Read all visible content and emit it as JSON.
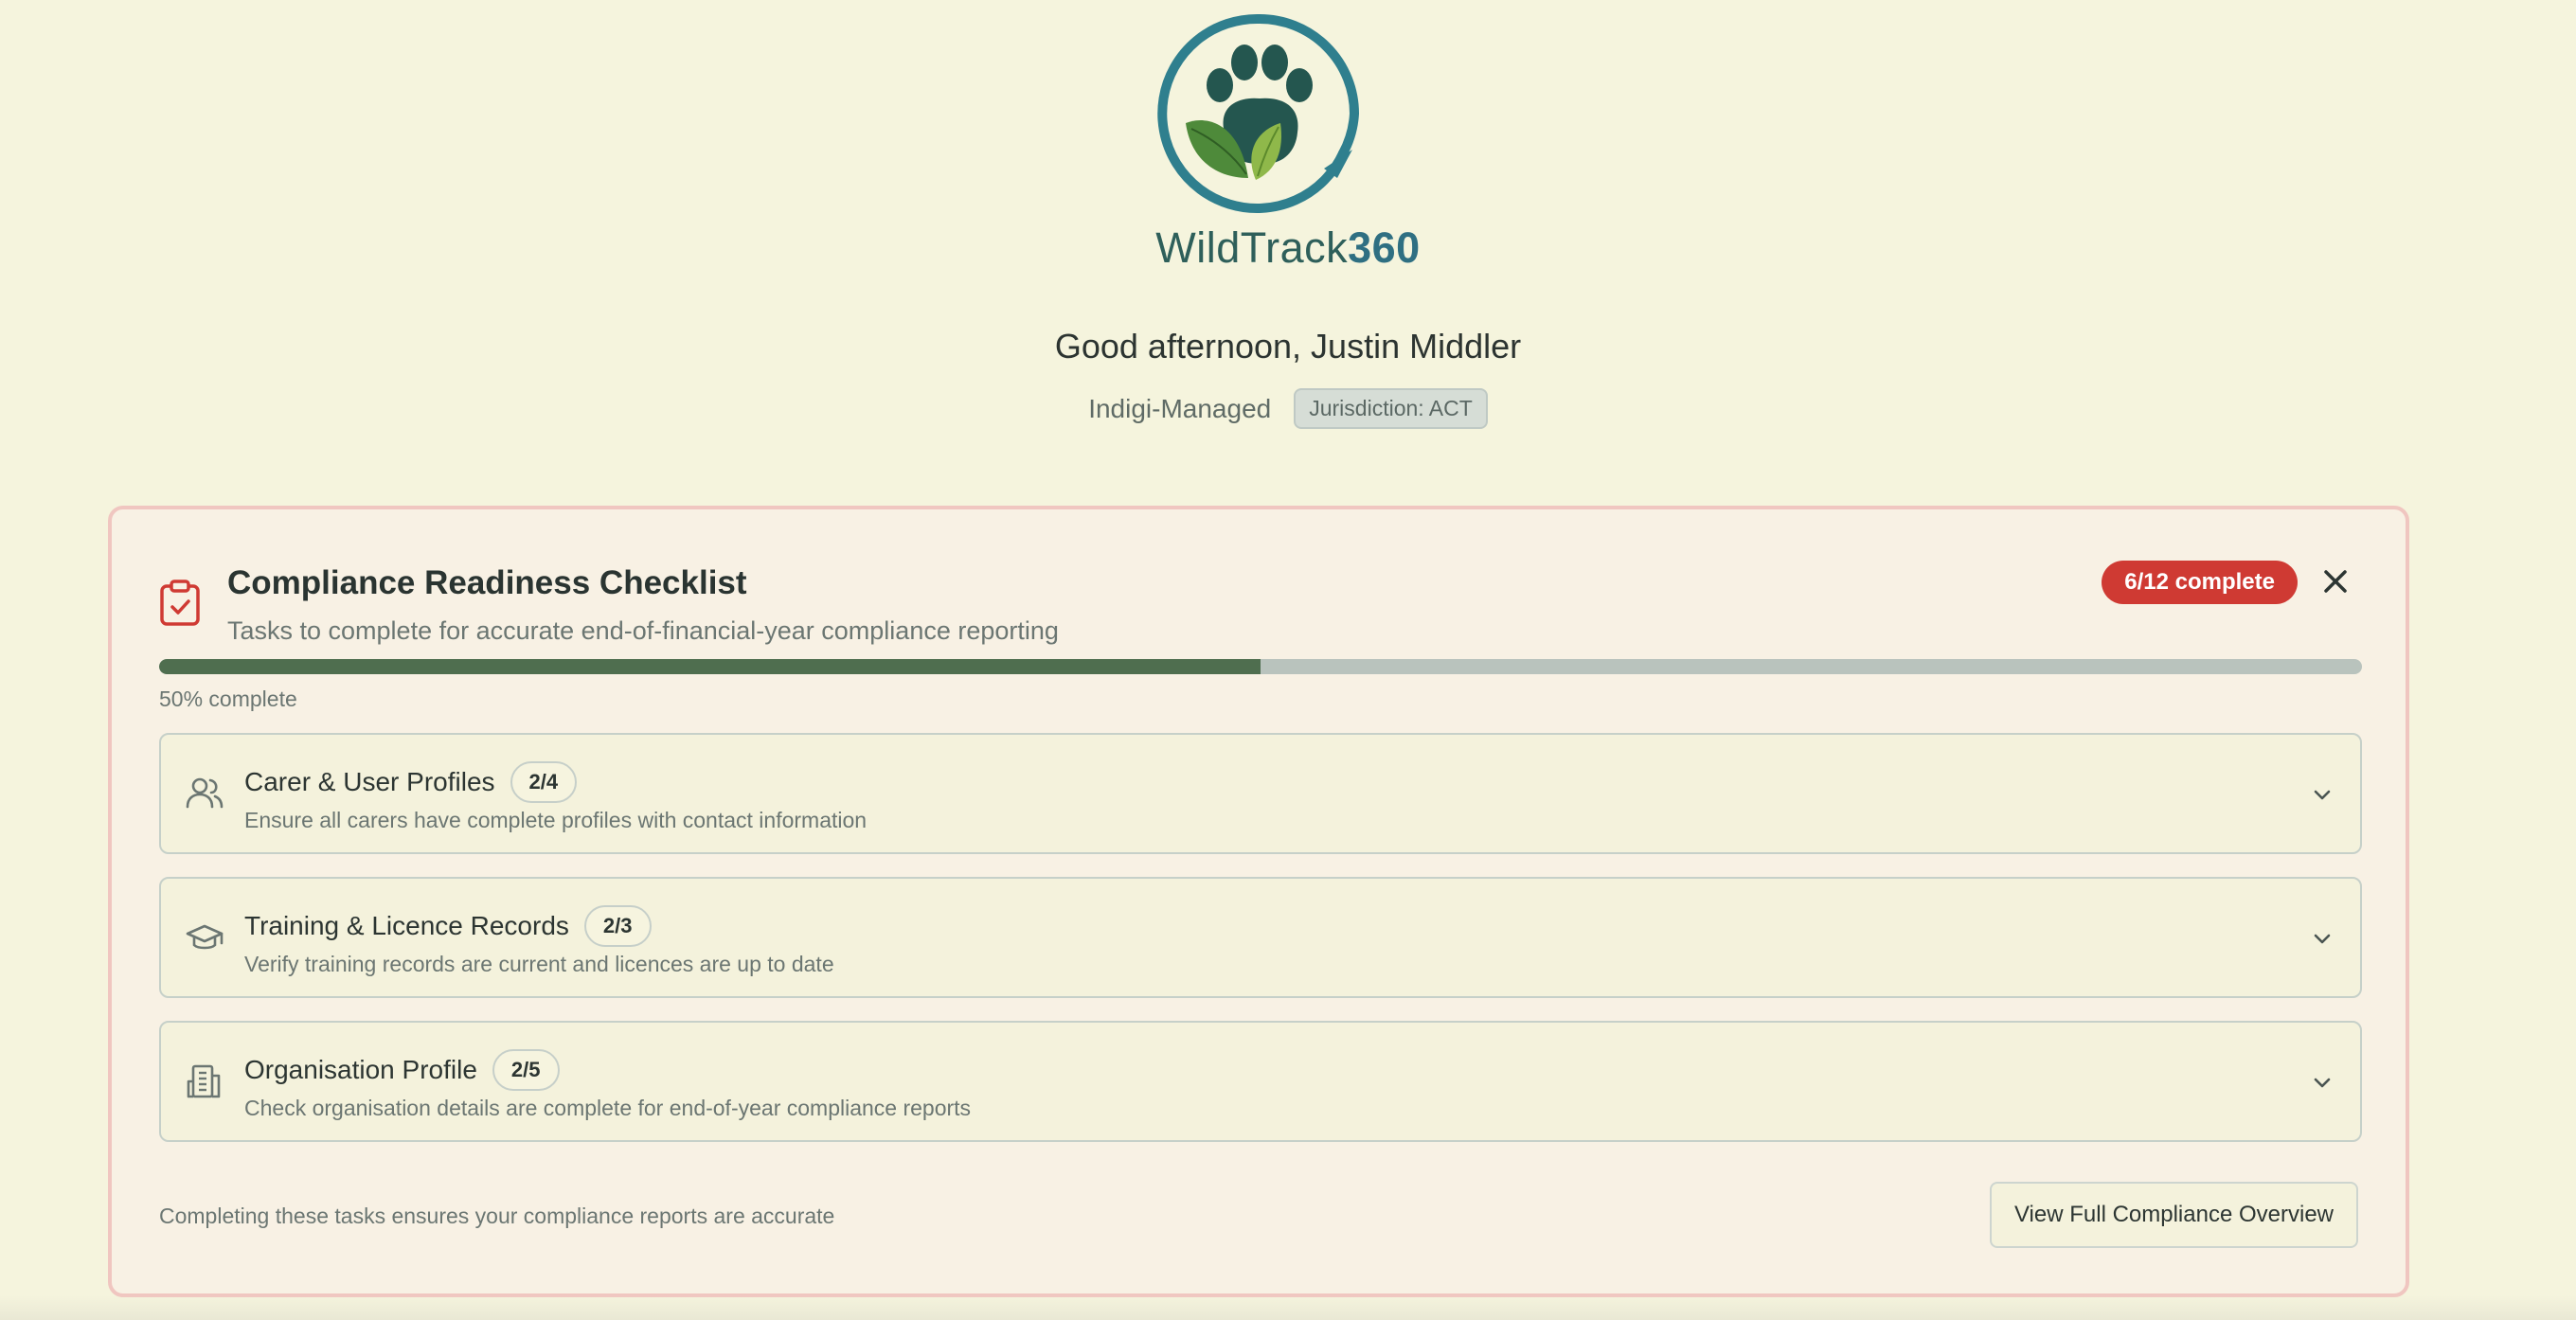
{
  "brand": {
    "name_text": "WildTrack",
    "name_number": "360"
  },
  "header": {
    "greeting": "Good afternoon, Justin Middler",
    "org_type": "Indigi-Managed",
    "jurisdiction": "Jurisdiction: ACT"
  },
  "checklist": {
    "title": "Compliance Readiness Checklist",
    "subtitle": "Tasks to complete for accurate end-of-financial-year compliance reporting",
    "badge": "6/12 complete",
    "progress_percent": 50,
    "progress_label": "50% complete",
    "sections": [
      {
        "title": "Carer & User Profiles",
        "count": "2/4",
        "description": "Ensure all carers have complete profiles with contact information",
        "icon": "users-icon"
      },
      {
        "title": "Training & Licence Records",
        "count": "2/3",
        "description": "Verify training records are current and licences are up to date",
        "icon": "graduation-cap-icon"
      },
      {
        "title": "Organisation Profile",
        "count": "2/5",
        "description": "Check organisation details are complete for end-of-year compliance reports",
        "icon": "building-icon"
      }
    ],
    "footer_note": "Completing these tasks ensures your compliance reports are accurate",
    "overview_button": "View Full Compliance Overview"
  },
  "colors": {
    "background": "#f5f4dd",
    "accent_red": "#cf3a33",
    "progress_green": "#4f6e4f",
    "brand_teal": "#2e5f5a"
  }
}
